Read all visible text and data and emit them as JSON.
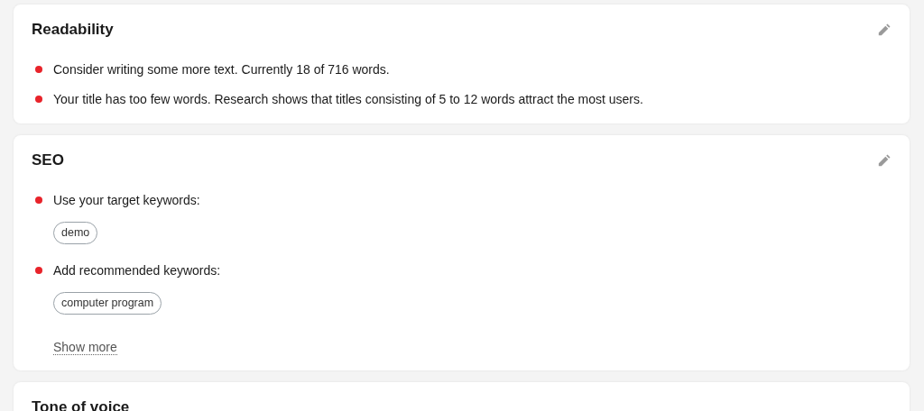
{
  "cards": [
    {
      "title": "Readability",
      "editable": true,
      "items": [
        {
          "text": "Consider writing some more text. Currently 18 of 716 words."
        },
        {
          "text": "Your title has too few words. Research shows that titles consisting of 5 to 12 words attract the most users."
        }
      ]
    },
    {
      "title": "SEO",
      "editable": true,
      "items": [
        {
          "text": "Use your target keywords:",
          "keywords": [
            "demo"
          ]
        },
        {
          "text": "Add recommended keywords:",
          "keywords": [
            "computer program"
          ]
        }
      ],
      "link": "Show more"
    },
    {
      "title": "Tone of voice",
      "editable": false
    }
  ]
}
